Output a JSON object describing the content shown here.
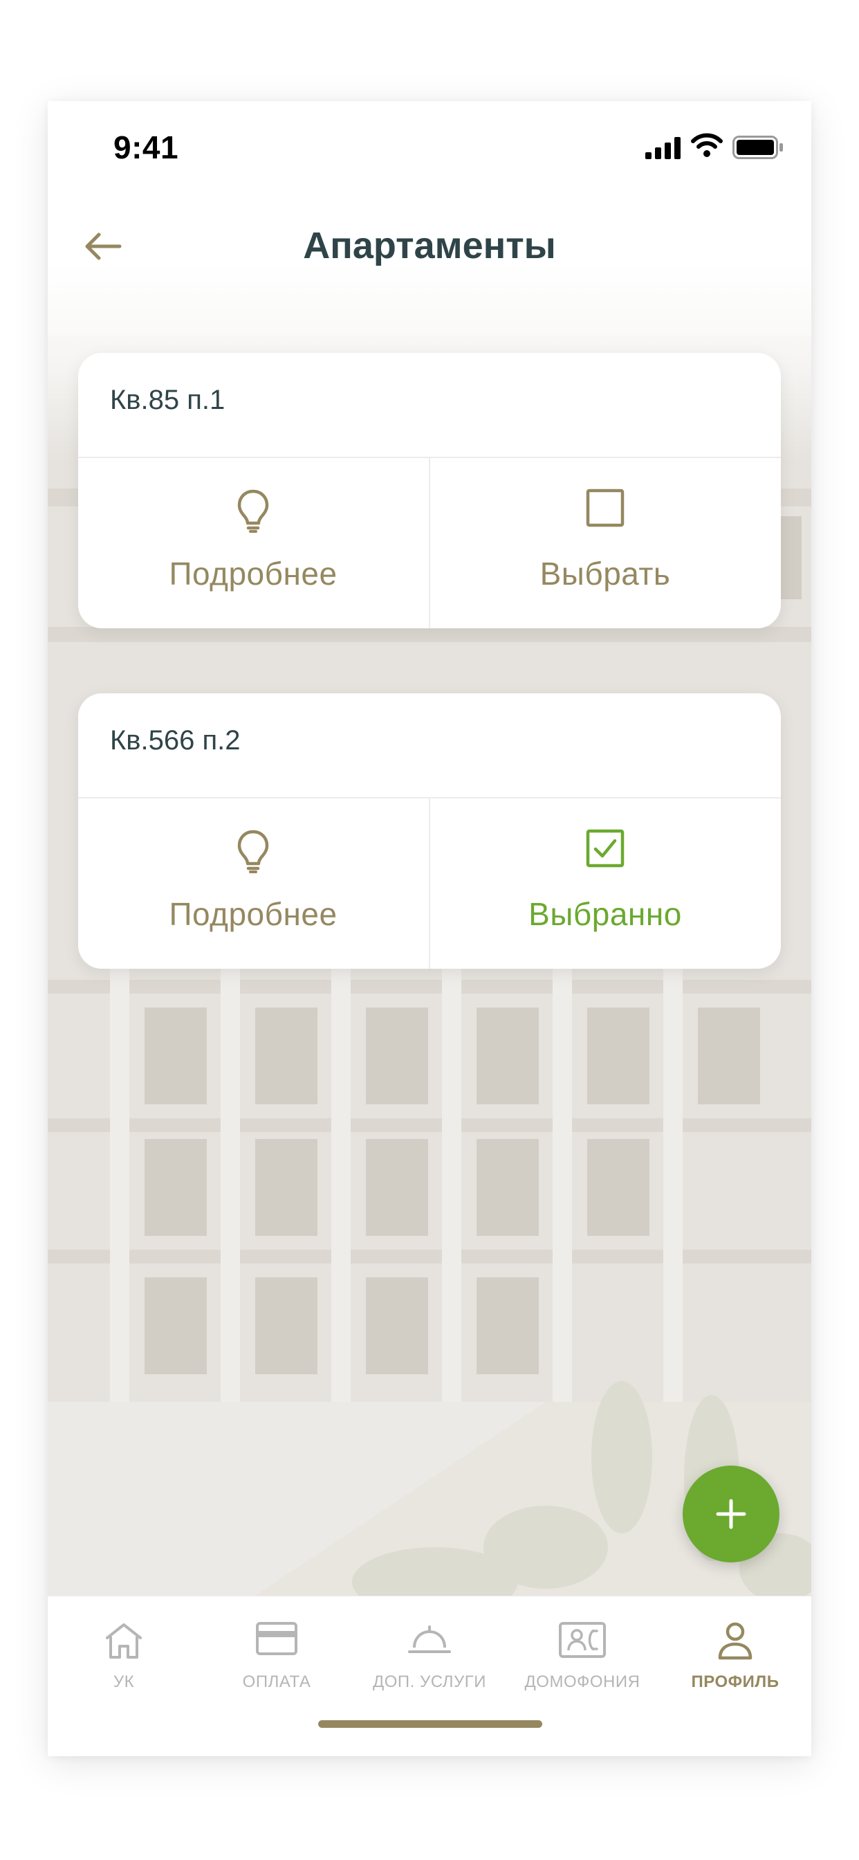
{
  "status_bar": {
    "time": "9:41"
  },
  "header": {
    "title": "Апартаменты"
  },
  "apartments": [
    {
      "name": "Кв.85 п.1",
      "details_label": "Подробнее",
      "select_label": "Выбрать",
      "selected": false
    },
    {
      "name": "Кв.566 п.2",
      "details_label": "Подробнее",
      "select_label": "Выбранно",
      "selected": true
    }
  ],
  "tabs": [
    {
      "label": "УК",
      "icon": "home-icon",
      "active": false
    },
    {
      "label": "ОПЛАТА",
      "icon": "card-icon",
      "active": false
    },
    {
      "label": "ДОП. УСЛУГИ",
      "icon": "cloche-icon",
      "active": false
    },
    {
      "label": "ДОМОФОНИЯ",
      "icon": "intercom-icon",
      "active": false
    },
    {
      "label": "ПРОФИЛЬ",
      "icon": "person-icon",
      "active": true
    }
  ],
  "colors": {
    "accent_gold": "#958860",
    "selected_green": "#6ba92f",
    "title_dark": "#2f4448",
    "inactive_gray": "#b5b5b5"
  }
}
